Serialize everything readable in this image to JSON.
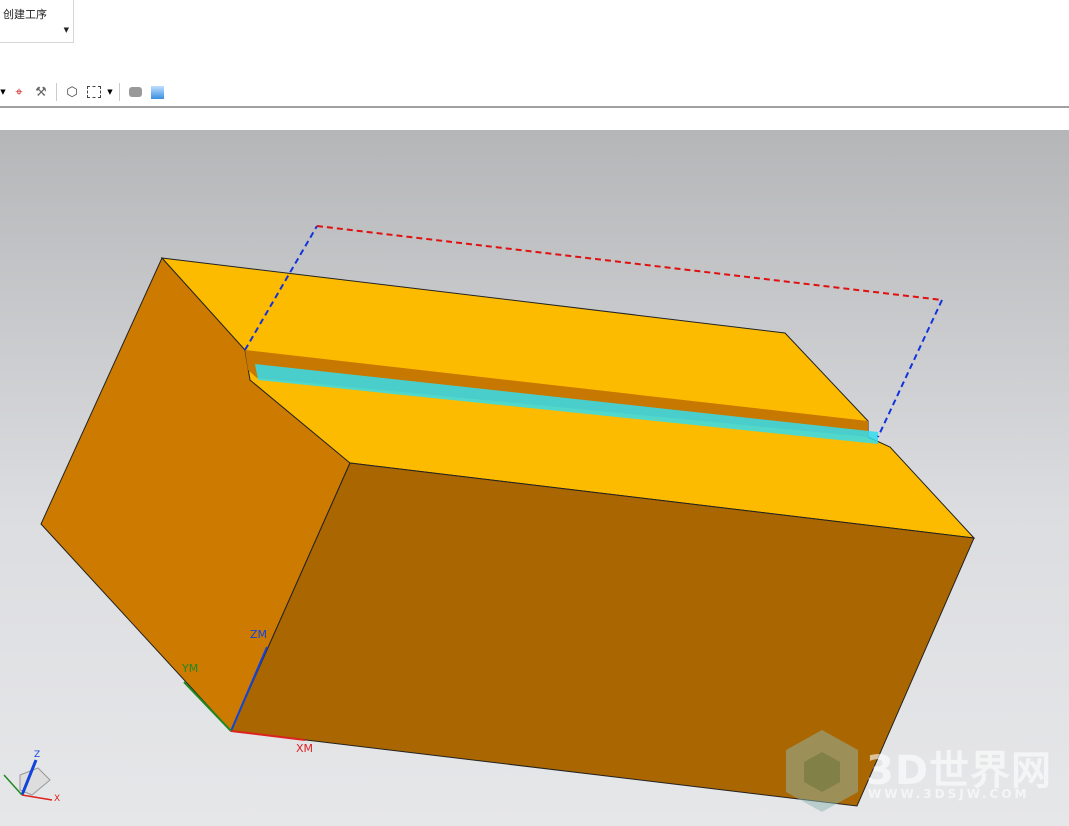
{
  "ribbon": {
    "create_operation_label": "创建工序"
  },
  "toolbar": {
    "icons": [
      "rotate-icon",
      "measure-icon",
      "hexagon-select-icon",
      "rectangle-select-icon",
      "shaded-view-icon",
      "cube-view-icon"
    ]
  },
  "viewport": {
    "axis_labels": {
      "zm": "ZM",
      "xm": "XM",
      "ym": "YM"
    },
    "view_triad": {
      "z": "Z",
      "x": "X"
    }
  },
  "watermark": {
    "title": "3D世界网",
    "url": "WWW.3DSJW.COM"
  },
  "colors": {
    "top": "#fdbb00",
    "left": "#cc7a00",
    "front": "#aa6600",
    "slot": "#33ddee"
  }
}
